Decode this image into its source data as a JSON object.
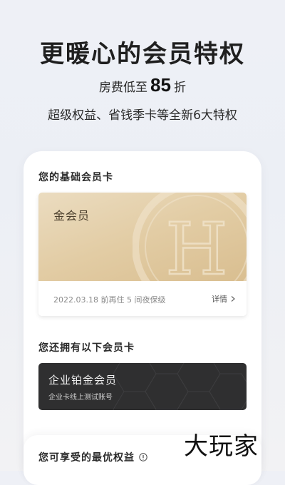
{
  "hero": {
    "title": "更暖心的会员特权",
    "discount_prefix": "房费低至",
    "discount_value": "85",
    "discount_suffix": "折",
    "subtitle": "超级权益、省钱季卡等全新6大特权"
  },
  "basic_card_section": {
    "label": "您的基础会员卡",
    "card_name": "金会员",
    "emblem_letter": "H",
    "note": "2022.03.18 前再住 5 间夜保级",
    "detail_label": "详情"
  },
  "owned_cards_section": {
    "label": "您还拥有以下会员卡",
    "cards": [
      {
        "name": "企业铂金会员",
        "subtitle": "企业卡线上测试账号"
      }
    ]
  },
  "benefits_section": {
    "label": "您可享受的最优权益"
  },
  "watermark": "大玩家",
  "colors": {
    "gold_light": "#ebdcc0",
    "gold_dark": "#d9be90",
    "platinum_bg": "#2f2f30",
    "page_bg": "#eef0f6"
  },
  "icons": {
    "detail": "chevron-right-icon",
    "benefits_info": "info-icon"
  }
}
